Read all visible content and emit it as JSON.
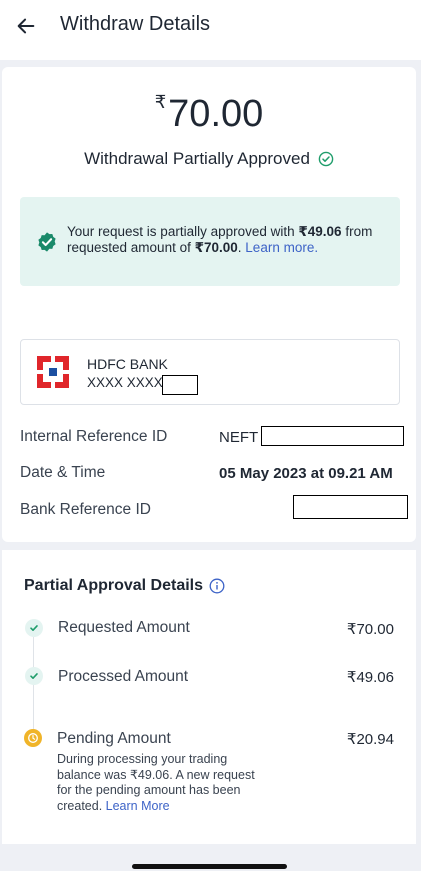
{
  "header": {
    "title": "Withdraw Details",
    "back_icon": "arrow-left-icon"
  },
  "summary": {
    "currency_symbol": "₹",
    "amount": "70.00",
    "status_text": "Withdrawal Partially Approved",
    "status_color": "#1f9d6b"
  },
  "notice": {
    "text_before": "Your request is partially approved with ",
    "approved_amount": "₹49.06",
    "text_middle": " from requested amount of ",
    "requested_amount": "₹70.00",
    "text_after": ". ",
    "link_label": "Learn more.",
    "background": "#e4f4f1"
  },
  "bank": {
    "name": "HDFC BANK",
    "account_masked": "XXXX XXXX",
    "logo_colors": {
      "red": "#e0262b",
      "blue": "#1b4fa1"
    }
  },
  "details": {
    "internal_ref_label": "Internal Reference ID",
    "internal_ref_value": "NEFT",
    "datetime_label": "Date & Time",
    "datetime_value": "05 May 2023 at 09.21 AM",
    "bank_ref_label": "Bank Reference ID"
  },
  "partial": {
    "title": "Partial Approval Details",
    "steps": [
      {
        "label": "Requested Amount",
        "amount": "₹70.00",
        "state": "done"
      },
      {
        "label": "Processed Amount",
        "amount": "₹49.06",
        "state": "done"
      },
      {
        "label": "Pending Amount",
        "amount": "₹20.94",
        "state": "pending"
      }
    ],
    "pending_note": "During processing your trading balance was ₹49.06. A new request for the pending amount has been created. ",
    "pending_link": "Learn More"
  },
  "colors": {
    "accent_link": "#3d63c7",
    "success": "#1f9d6b",
    "pending": "#f0b429"
  }
}
